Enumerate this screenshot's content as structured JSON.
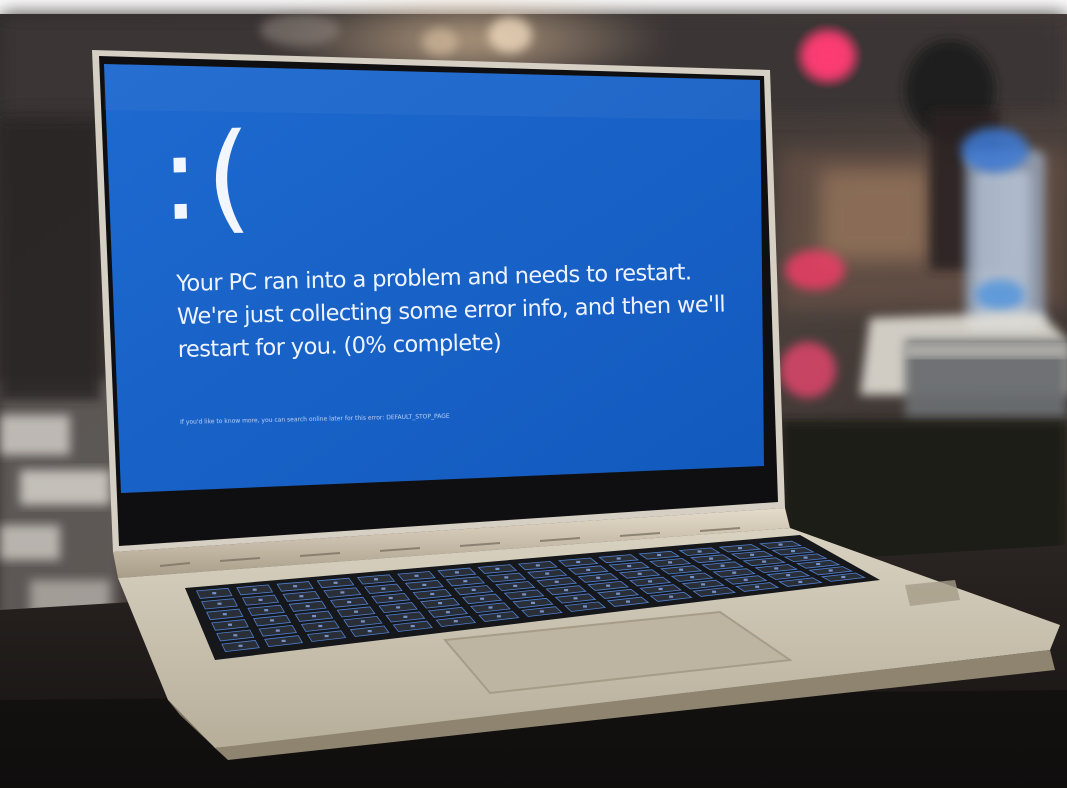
{
  "bsod": {
    "face": ":(",
    "message": "Your PC ran into a problem and needs to restart. We're just collecting some error info, and then we'll restart for you. (0% complete)",
    "fine_print": "If you'd like to know more, you can search online later for this error: DEFAULT_STOP_PAGE"
  },
  "colors": {
    "screen_blue": "#1662c8",
    "laptop_silver": "#c9c0ad",
    "keyboard_dark": "#1d1f24",
    "background_dark": "#3a3534"
  }
}
